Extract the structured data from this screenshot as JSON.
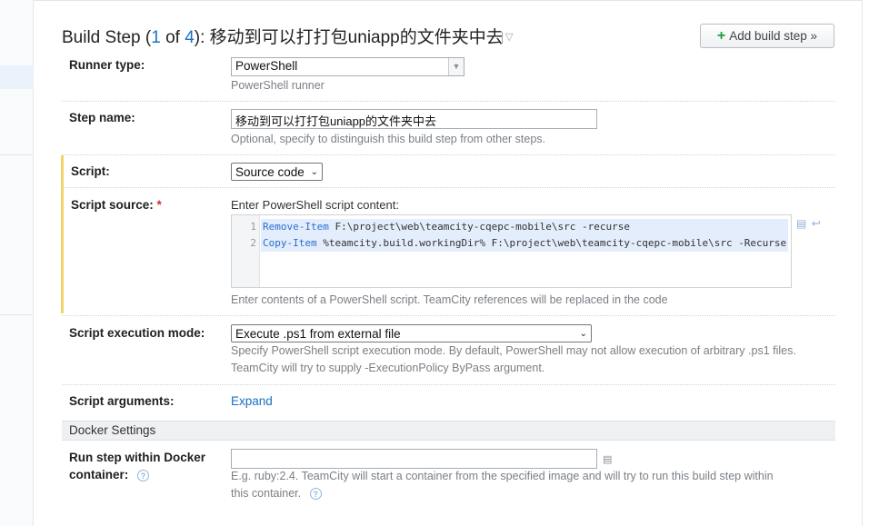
{
  "header": {
    "title_prefix": "Build Step (",
    "step_index": "1",
    "title_of": " of ",
    "step_total": "4",
    "title_suffix": "): 移动到可以打打包uniapp的文件夹中去",
    "add_button_plus": "+",
    "add_button_label": "Add build step »"
  },
  "runner": {
    "label": "Runner type:",
    "value": "PowerShell",
    "hint": "PowerShell runner"
  },
  "step_name": {
    "label": "Step name:",
    "value": "移动到可以打打包uniapp的文件夹中去",
    "hint": "Optional, specify to distinguish this build step from other steps."
  },
  "script": {
    "label": "Script:",
    "value": "Source code"
  },
  "script_source": {
    "label": "Script source:",
    "required_mark": "*",
    "intro": "Enter PowerShell script content:",
    "lines": [
      {
        "num": "1",
        "kw": "Remove-Item",
        "rest": " F:\\project\\web\\teamcity-cqepc-mobile\\src -recurse"
      },
      {
        "num": "2",
        "kw": "Copy-Item",
        "rest": " %teamcity.build.workingDir% F:\\project\\web\\teamcity-cqepc-mobile\\src -Recurse"
      }
    ],
    "hint": "Enter contents of a PowerShell script. TeamCity references will be replaced in the code",
    "icon_list": "list-icon",
    "icon_wrap": "wrap-icon"
  },
  "execution_mode": {
    "label": "Script execution mode:",
    "value": "Execute .ps1 from external file",
    "hint_line1": "Specify PowerShell script execution mode. By default, PowerShell may not allow execution of arbitrary .ps1 files.",
    "hint_line2": "TeamCity will try to supply -ExecutionPolicy ByPass argument."
  },
  "arguments": {
    "label": "Script arguments:",
    "link": "Expand"
  },
  "docker": {
    "section_title": "Docker Settings",
    "label_line1": "Run step within Docker",
    "label_line2": "container:",
    "help_glyph": "?",
    "value": "",
    "hint_line1": "E.g. ruby:2.4. TeamCity will start a container from the specified image and will try to run this build step within",
    "hint_line2": "this container."
  }
}
